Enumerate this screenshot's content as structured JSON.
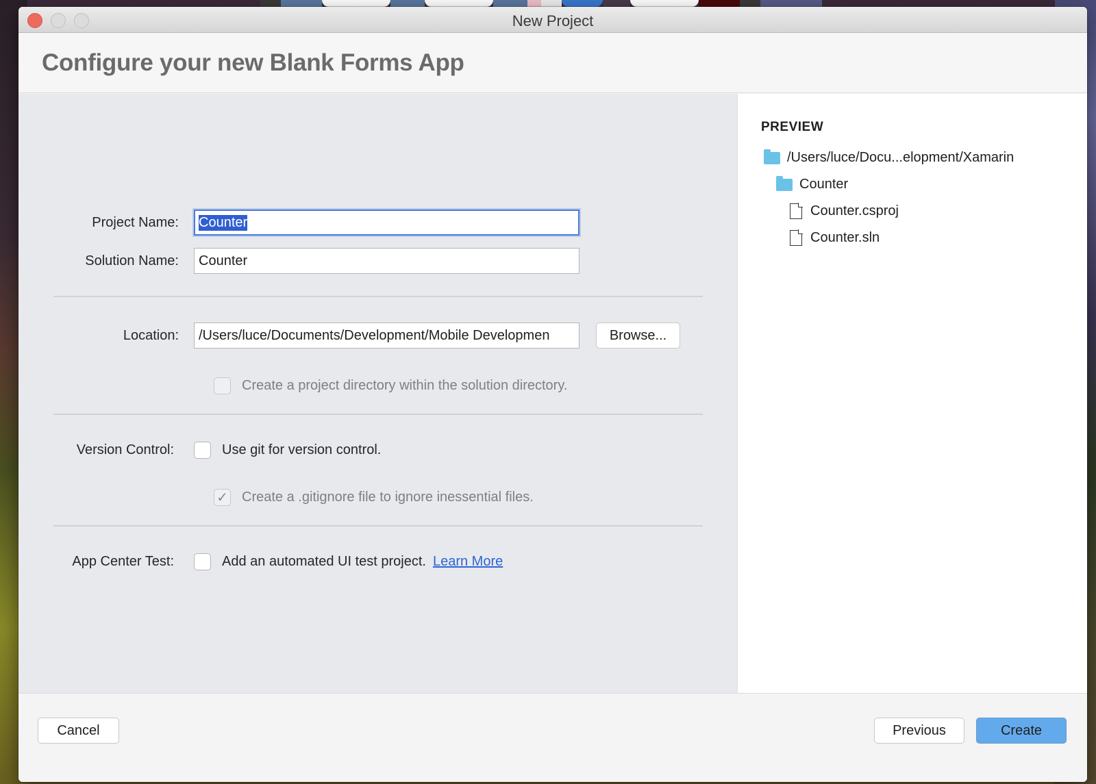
{
  "window": {
    "title": "New Project"
  },
  "header": {
    "title": "Configure your new Blank Forms App"
  },
  "form": {
    "project_name": {
      "label": "Project Name:",
      "value": "Counter",
      "focused": true,
      "selected": true
    },
    "solution_name": {
      "label": "Solution Name:",
      "value": "Counter"
    },
    "location": {
      "label": "Location:",
      "value": "/Users/luce/Documents/Development/Mobile Developmen",
      "browse_label": "Browse..."
    },
    "project_dir_checkbox": {
      "label": "Create a project directory within the solution directory.",
      "checked": false,
      "disabled": true
    },
    "version_control": {
      "label": "Version Control:",
      "use_git": {
        "label": "Use git for version control.",
        "checked": false
      },
      "gitignore": {
        "label": "Create a .gitignore file to ignore inessential files.",
        "checked": true,
        "disabled": true,
        "check_glyph": "✓"
      }
    },
    "app_center_test": {
      "label": "App Center Test:",
      "checkbox": {
        "label": "Add an automated UI test project.",
        "checked": false
      },
      "learn_more": "Learn More"
    }
  },
  "preview": {
    "title": "PREVIEW",
    "tree": [
      {
        "type": "folder",
        "name": "/Users/luce/Docu...elopment/Xamarin",
        "depth": 0,
        "icon": "folder-icon"
      },
      {
        "type": "folder",
        "name": "Counter",
        "depth": 1,
        "icon": "folder-icon"
      },
      {
        "type": "file",
        "name": "Counter.csproj",
        "depth": 2,
        "icon": "file-icon"
      },
      {
        "type": "file",
        "name": "Counter.sln",
        "depth": 2,
        "icon": "file-icon"
      }
    ]
  },
  "footer": {
    "cancel": "Cancel",
    "previous": "Previous",
    "create": "Create"
  },
  "colors": {
    "accent": "#63aaec",
    "focus_ring": "#4a7bd8",
    "selection": "#2f5fd0",
    "link": "#2b66d9",
    "folder": "#6ac3e6",
    "close_button": "#ee6a5e"
  }
}
